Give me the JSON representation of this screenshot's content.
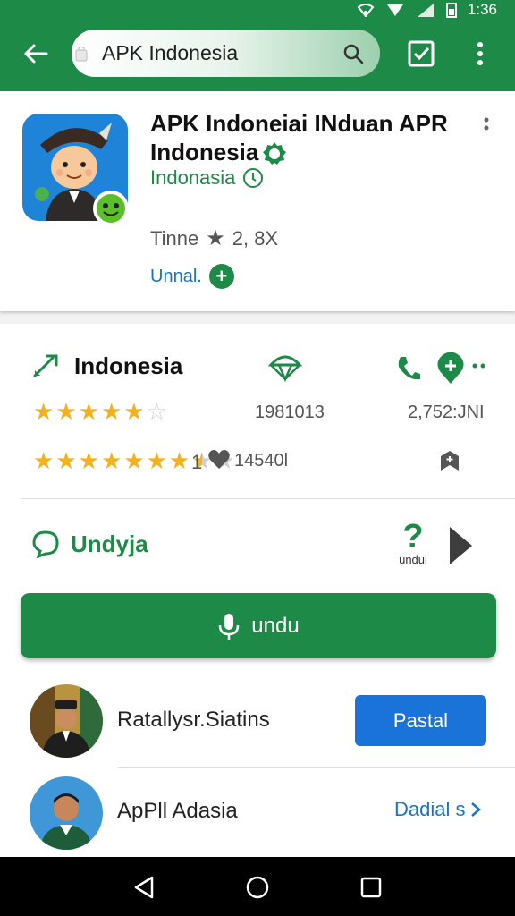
{
  "status_bar": {
    "time": "1:36"
  },
  "search": {
    "query": "APK Indonesia"
  },
  "app": {
    "title": "APK Indoneiai INduan APR Indonesia",
    "developer": "Indonasia",
    "rating_label": "Tinne",
    "rating_value": "2, 8X",
    "install_link": "Unnal."
  },
  "details": {
    "category_label": "Indonesia",
    "stat1": "1981013",
    "stat2": "2,752:JNI",
    "review_count_prefix": "1",
    "review_count": "14540l",
    "rating1_stars": 4.5,
    "rating2_stars": 7.5,
    "section_label": "Undyja",
    "help_caption": "undui",
    "primary_button": "undu"
  },
  "list": {
    "items": [
      {
        "name": "Ratallysr.Siatins",
        "action": "Pastal"
      },
      {
        "name": "ApPll Adasia",
        "action": "Dadial s"
      }
    ]
  },
  "colors": {
    "primary_green": "#1e8a47",
    "accent_blue": "#1a73d9",
    "star": "#f4b11e"
  }
}
